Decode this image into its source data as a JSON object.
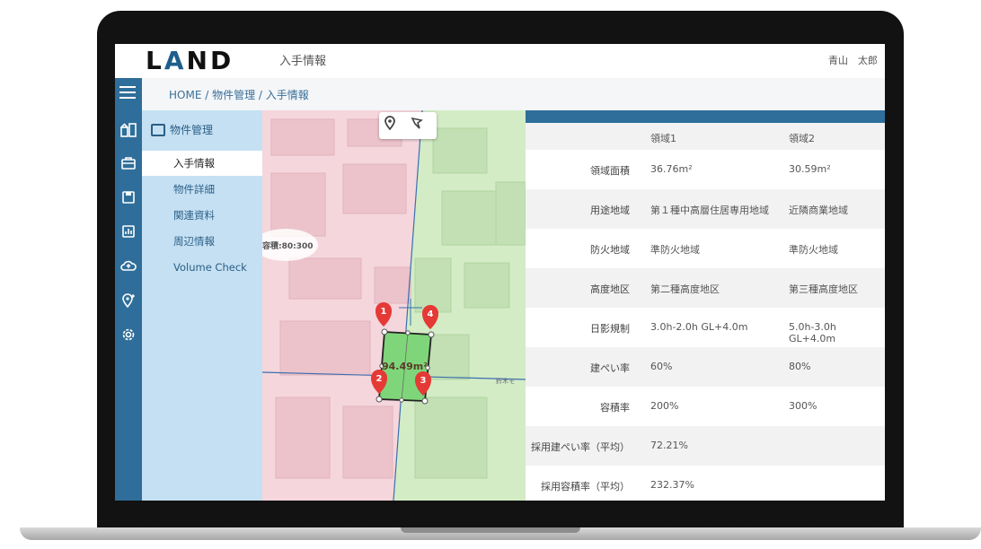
{
  "app": {
    "logo_l": "L",
    "logo_a": "A",
    "logo_nd": "ND",
    "page_title": "入手情報",
    "user_name": "青山　太郎"
  },
  "breadcrumb": "HOME / 物件管理 / 入手情報",
  "sidebar": {
    "heading": "物件管理",
    "items": [
      {
        "label": "入手情報"
      },
      {
        "label": "物件詳細"
      },
      {
        "label": "関連資料"
      },
      {
        "label": "周辺情報"
      },
      {
        "label": "Volume Check"
      }
    ]
  },
  "map": {
    "area_label": "94.49m²",
    "bubble_text": "容積:80:300",
    "street_label": "鈴木モ",
    "markers": [
      "1",
      "2",
      "3",
      "4"
    ],
    "tools": [
      "pin-icon",
      "polygon-tool-icon"
    ]
  },
  "table": {
    "columns": [
      "",
      "領域1",
      "領域2"
    ],
    "rows": [
      {
        "label": "領域面積",
        "v1": "36.76m²",
        "v2": "30.59m²"
      },
      {
        "label": "用途地域",
        "v1": "第１種中高層住居専用地域",
        "v2": "近隣商業地域"
      },
      {
        "label": "防火地域",
        "v1": "準防火地域",
        "v2": "準防火地域"
      },
      {
        "label": "高度地区",
        "v1": "第二種高度地区",
        "v2": "第三種高度地区"
      },
      {
        "label": "日影規制",
        "v1": "3.0h-2.0h GL+4.0m",
        "v2": "5.0h-3.0h GL+4.0m"
      },
      {
        "label": "建ぺい率",
        "v1": "60%",
        "v2": "80%"
      },
      {
        "label": "容積率",
        "v1": "200%",
        "v2": "300%"
      },
      {
        "label": "採用建ぺい率（平均）",
        "v1": "72.21%",
        "v2": ""
      },
      {
        "label": "採用容積率（平均）",
        "v1": "232.37%",
        "v2": ""
      }
    ]
  },
  "colors": {
    "accent": "#2f6e9a",
    "sidebar": "#c5e0f2",
    "zone_pink": "#f4d6dc",
    "zone_green": "#d3ecc6",
    "parcel": "#7fd67a",
    "marker": "#e53935"
  }
}
